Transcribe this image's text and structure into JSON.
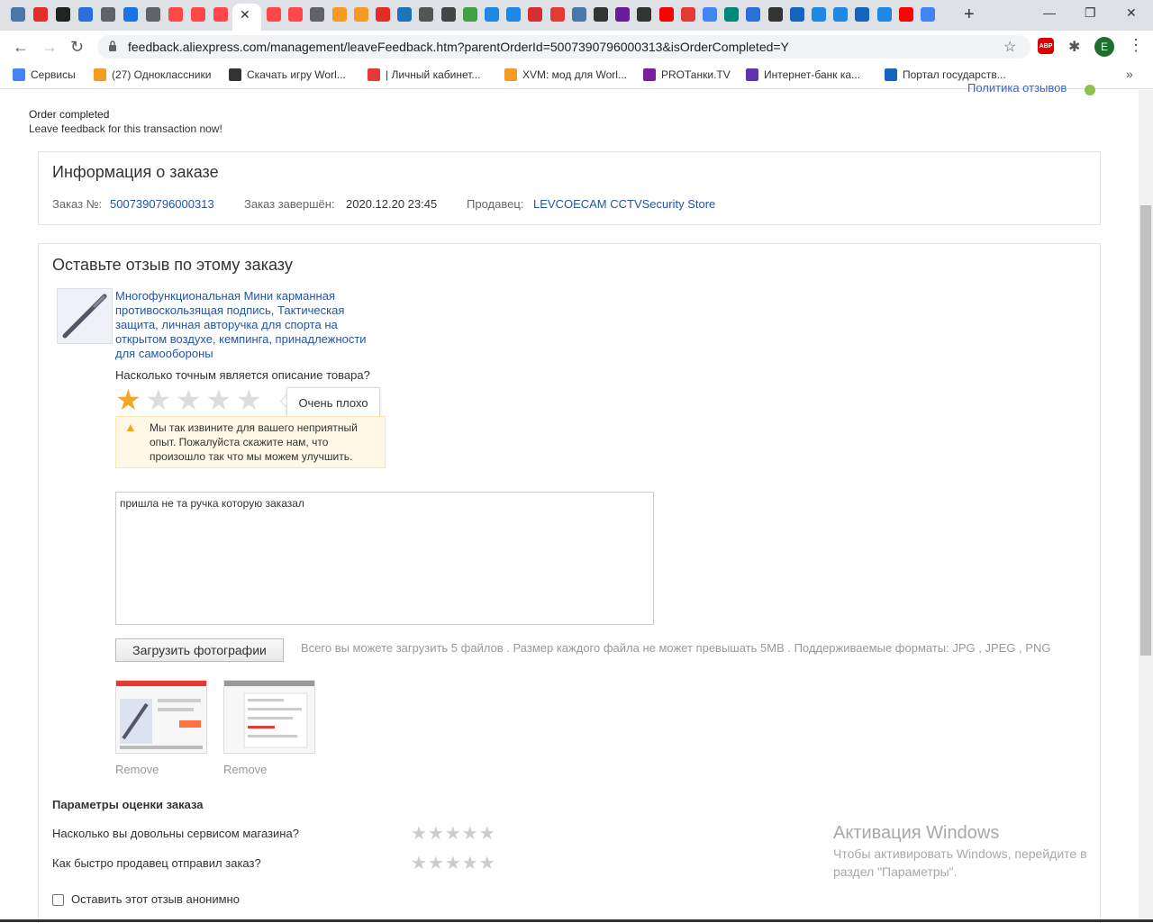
{
  "browser": {
    "tab_icons": [
      {
        "name": "vk-tab-icon",
        "color": "#4a76a8"
      },
      {
        "name": "red-dot-tab-icon",
        "color": "#e52d27"
      },
      {
        "name": "plus-tab-icon",
        "color": "#222222"
      },
      {
        "name": "mail-tab-icon",
        "color": "#2a6fdb"
      },
      {
        "name": "globe-tab-icon",
        "color": "#5f6368"
      },
      {
        "name": "meet-tab-icon",
        "color": "#1a73e8"
      },
      {
        "name": "globe-tab-icon",
        "color": "#5f6368"
      },
      {
        "name": "aliexpress-tab-icon",
        "color": "#ff4747"
      },
      {
        "name": "aliexpress-tab-icon",
        "color": "#ff4747"
      },
      {
        "name": "aliexpress-tab-icon",
        "color": "#ff4747"
      }
    ],
    "tab_icons_right": [
      {
        "name": "aliexpress-tab-icon",
        "color": "#ff4747"
      },
      {
        "name": "aliexpress-tab-icon",
        "color": "#ff4747"
      },
      {
        "name": "globe-tab-icon",
        "color": "#5f6368"
      },
      {
        "name": "odnoklassniki-tab-icon",
        "color": "#f59a23"
      },
      {
        "name": "odnoklassniki-tab-icon",
        "color": "#f59a23"
      },
      {
        "name": "yandex-tab-icon",
        "color": "#e52d27"
      },
      {
        "name": "cloud-tab-icon",
        "color": "#1b75bc"
      },
      {
        "name": "d-tab-icon",
        "color": "#555555"
      },
      {
        "name": "arrow-tab-icon",
        "color": "#444444"
      },
      {
        "name": "green-tab-icon",
        "color": "#43a047"
      },
      {
        "name": "flame-tab-icon",
        "color": "#1e88e5"
      },
      {
        "name": "flame-tab-icon",
        "color": "#1e88e5"
      },
      {
        "name": "red-circle-tab-icon",
        "color": "#d32f2f"
      },
      {
        "name": "red-drop-tab-icon",
        "color": "#e53935"
      },
      {
        "name": "vk-tab-icon",
        "color": "#4a76a8"
      },
      {
        "name": "as-tab-icon",
        "color": "#333333"
      },
      {
        "name": "purple-tab-icon",
        "color": "#6a1b9a"
      },
      {
        "name": "film-tab-icon",
        "color": "#333333"
      },
      {
        "name": "youtube-tab-icon",
        "color": "#ff0000"
      },
      {
        "name": "red-grid-tab-icon",
        "color": "#e53935"
      },
      {
        "name": "google-tab-icon",
        "color": "#4285f4"
      },
      {
        "name": "teal-tab-icon",
        "color": "#00897b"
      },
      {
        "name": "mail-tab-icon",
        "color": "#2a6fdb"
      },
      {
        "name": "gear-tab-icon",
        "color": "#333333"
      },
      {
        "name": "flag-tab-icon",
        "color": "#1565c0"
      },
      {
        "name": "flame-tab-icon",
        "color": "#1e88e5"
      },
      {
        "name": "flame-tab-icon",
        "color": "#1e88e5"
      },
      {
        "name": "flag-tab-icon",
        "color": "#1565c0"
      },
      {
        "name": "flame-tab-icon",
        "color": "#1e88e5"
      },
      {
        "name": "youtube-tab-icon",
        "color": "#ff0000"
      },
      {
        "name": "google-tab-icon",
        "color": "#4285f4"
      }
    ],
    "url": "feedback.aliexpress.com/management/leaveFeedback.htm?parentOrderId=5007390796000313&isOrderCompleted=Y",
    "avatar_letter": "E",
    "abp_label": "ABP",
    "bookmarks": [
      {
        "name": "services",
        "label": "Сервисы",
        "color": "#4285f4"
      },
      {
        "name": "odnoklassniki",
        "label": "(27) Одноклассники",
        "color": "#f59a23"
      },
      {
        "name": "world-of-tanks",
        "label": "Скачать игру Worl...",
        "color": "#333333"
      },
      {
        "name": "personal-cabinet",
        "label": "| Личный кабинет...",
        "color": "#e53935"
      },
      {
        "name": "xvm",
        "label": "XVM: мод для Worl...",
        "color": "#f59a23"
      },
      {
        "name": "protanki",
        "label": "PROТанки.TV",
        "color": "#7b1fa2"
      },
      {
        "name": "internet-bank",
        "label": "Интернет-банк ка...",
        "color": "#5e35b1"
      },
      {
        "name": "gosuslugi",
        "label": "Портал государств...",
        "color": "#1565c0"
      }
    ]
  },
  "page": {
    "cut_link": "Политика отзывов",
    "order_completed_title": "Order completed",
    "order_completed_sub": "Leave feedback for this transaction now!",
    "order_info": {
      "heading": "Информация о заказе",
      "order_no_label": "Заказ №:",
      "order_no": "5007390796000313",
      "completed_label": "Заказ завершён:",
      "completed_value": "2020.12.20 23:45",
      "seller_label": "Продавец:",
      "seller": "LEVCOECAM CCTVSecurity Store"
    },
    "feedback": {
      "heading": "Оставьте отзыв по этому заказу",
      "product_title": "Многофункциональная Мини карманная противоскользящая подпись, Тактическая защита, личная авторучка для спорта на открытом воздухе, кемпинга, принадлежности для самообороны",
      "question": "Насколько точным является описание товара?",
      "rating": 1,
      "rating_max": 5,
      "tooltip": "Очень плохо",
      "warning": "Мы так извините для вашего неприятный опыт. Пожалуйста скажите нам, что произошло так что мы можем улучшить.",
      "comment": "пришла не та ручка которую заказал",
      "upload_button": "Загрузить фотографии",
      "upload_note": "Всего вы можете загрузить 5 файлов . Размер каждого файла не может превышать 5MB . Поддерживаемые форматы: JPG , JPEG , PNG",
      "remove_label": "Remove"
    },
    "params": {
      "title": "Параметры оценки заказа",
      "q1": "Насколько вы довольны сервисом магазина?",
      "q2": "Как быстро продавец отправил заказ?",
      "anonymous": "Оставить этот отзыв анонимно"
    }
  },
  "watermark": {
    "title": "Активация Windows",
    "text": "Чтобы активировать Windows, перейдите в раздел \"Параметры\"."
  }
}
